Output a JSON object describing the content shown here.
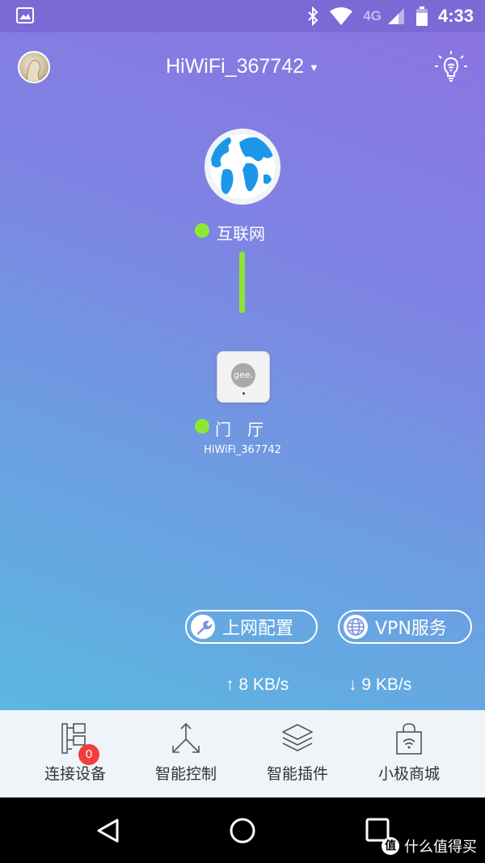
{
  "status_bar": {
    "network": "4G",
    "time": "4:33"
  },
  "header": {
    "ssid": "HiWiFi_367742",
    "dropdown_caret": "▼"
  },
  "topology": {
    "internet": {
      "label": "互联网",
      "status_color": "#8ee832"
    },
    "router": {
      "brand": "gee.",
      "label": "门　厅",
      "ssid": "HiWiFi_367742",
      "status_color": "#8ee832"
    }
  },
  "actions": {
    "network_config": {
      "label": "上网配置",
      "icon": "wrench-icon"
    },
    "vpn": {
      "label": "VPN服务",
      "icon": "globe-icon"
    }
  },
  "speed": {
    "upload": "8 KB/s",
    "download": "9 KB/s",
    "up_arrow": "↑",
    "down_arrow": "↓"
  },
  "tabs": [
    {
      "label": "连接设备",
      "icon": "devices-icon",
      "badge": "0"
    },
    {
      "label": "智能控制",
      "icon": "share-arrows-icon"
    },
    {
      "label": "智能插件",
      "icon": "layers-icon"
    },
    {
      "label": "小极商城",
      "icon": "shopping-bag-icon"
    }
  ],
  "watermark": {
    "icon_char": "值",
    "text": "什么值得买"
  },
  "colors": {
    "accent_green": "#8ee832",
    "badge_red": "#f23d3d",
    "tabbar_bg": "#eff4f8"
  }
}
